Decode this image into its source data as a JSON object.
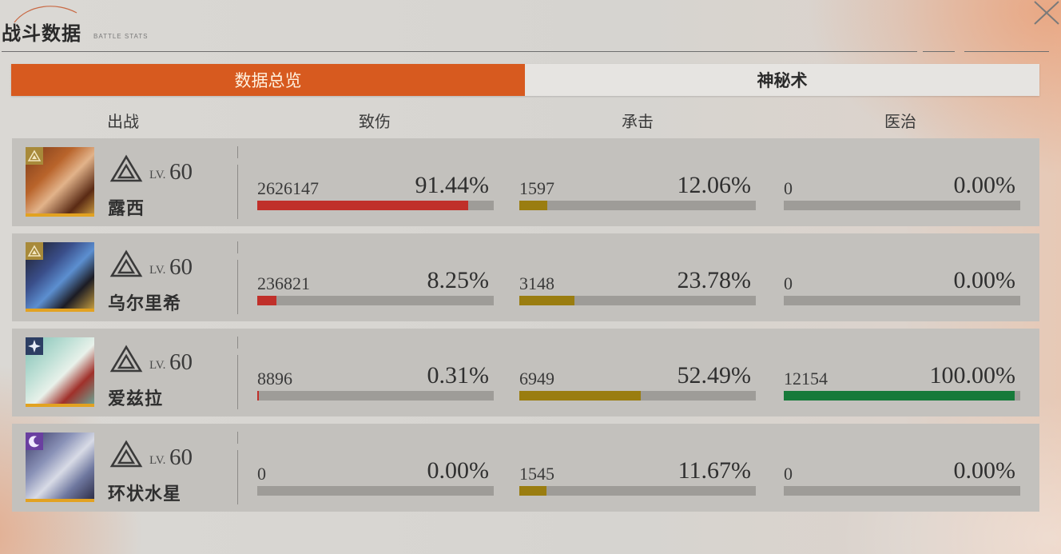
{
  "header": {
    "title": "战斗数据",
    "subtitle": "BATTLE STATS"
  },
  "tabs": [
    {
      "label": "数据总览",
      "active": true
    },
    {
      "label": "神秘术",
      "active": false
    }
  ],
  "columns": {
    "deploy": "出战",
    "damage": "致伤",
    "taken": "承击",
    "heal": "医治"
  },
  "colors": {
    "accent": "#d75a1f",
    "damage_bar": "#c0302a",
    "taken_bar": "#9a7d10",
    "heal_bar": "#177a3a",
    "bar_track": "#9e9c98"
  },
  "characters": [
    {
      "name": "露西",
      "lv_prefix": "LV.",
      "level": "60",
      "afflatus_icon": "mineral-triangle-icon",
      "damage": {
        "value": "2626147",
        "percent": "91.44%",
        "fraction": 0.9144
      },
      "taken": {
        "value": "1597",
        "percent": "12.06%",
        "fraction": 0.1206
      },
      "heal": {
        "value": "0",
        "percent": "0.00%",
        "fraction": 0.0
      }
    },
    {
      "name": "乌尔里希",
      "lv_prefix": "LV.",
      "level": "60",
      "afflatus_icon": "mineral-triangle-icon",
      "damage": {
        "value": "236821",
        "percent": "8.25%",
        "fraction": 0.0825
      },
      "taken": {
        "value": "3148",
        "percent": "23.78%",
        "fraction": 0.2378
      },
      "heal": {
        "value": "0",
        "percent": "0.00%",
        "fraction": 0.0
      }
    },
    {
      "name": "爱兹拉",
      "lv_prefix": "LV.",
      "level": "60",
      "afflatus_icon": "star-icon",
      "damage": {
        "value": "8896",
        "percent": "0.31%",
        "fraction": 0.0031
      },
      "taken": {
        "value": "6949",
        "percent": "52.49%",
        "fraction": 0.5249
      },
      "heal": {
        "value": "12154",
        "percent": "100.00%",
        "fraction": 1.0
      }
    },
    {
      "name": "环状水星",
      "lv_prefix": "LV.",
      "level": "60",
      "afflatus_icon": "moon-icon",
      "damage": {
        "value": "0",
        "percent": "0.00%",
        "fraction": 0.0
      },
      "taken": {
        "value": "1545",
        "percent": "11.67%",
        "fraction": 0.1167
      },
      "heal": {
        "value": "0",
        "percent": "0.00%",
        "fraction": 0.0
      }
    }
  ]
}
